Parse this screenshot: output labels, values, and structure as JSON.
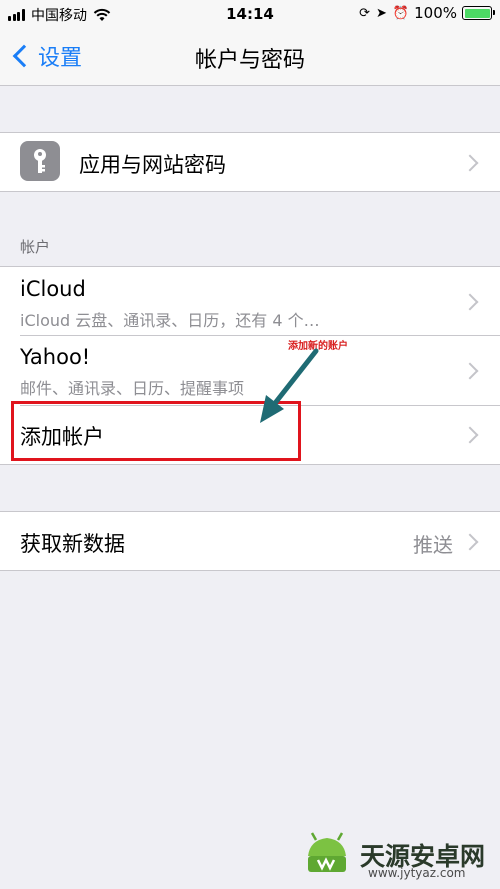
{
  "status_bar": {
    "carrier": "中国移动",
    "time": "14:14",
    "battery_percent": "100%",
    "battery_level": 1.0,
    "battery_color": "#4cd964"
  },
  "nav": {
    "back_label": "设置",
    "title": "帐户与密码",
    "tint": "#1a7ef7"
  },
  "passwords_row": {
    "label": "应用与网站密码",
    "icon": "key-icon"
  },
  "accounts_section": {
    "header": "帐户",
    "items": [
      {
        "title": "iCloud",
        "subtitle": "iCloud 云盘、通讯录、日历，还有 4 个…"
      },
      {
        "title": "Yahoo!",
        "subtitle": "邮件、通讯录、日历、提醒事项"
      }
    ],
    "add_account_label": "添加帐户"
  },
  "fetch_row": {
    "label": "获取新数据",
    "value": "推送"
  },
  "annotation": {
    "label": "添加新的账户",
    "color": "#e0141d",
    "arrow_color": "#1f6b74"
  },
  "watermark": {
    "name": "天源安卓网",
    "url": "www.jytyaz.com"
  }
}
